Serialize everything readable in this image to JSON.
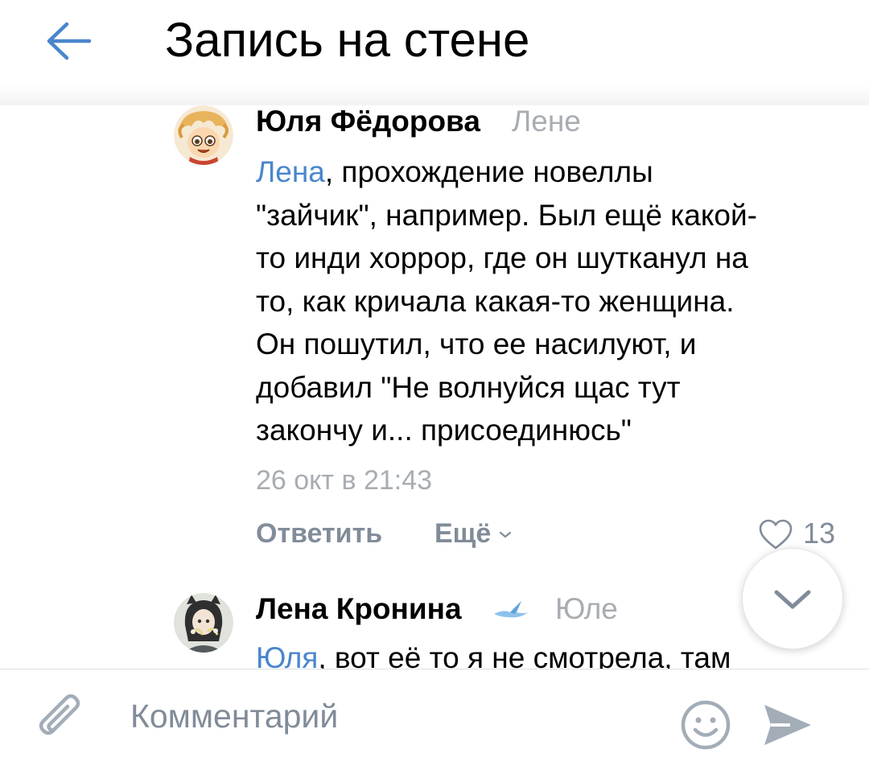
{
  "header": {
    "title": "Запись на стене",
    "back_icon": "arrow-left-icon",
    "accent_color": "#4986cc"
  },
  "comments": [
    {
      "author": "Юля Фёдорова",
      "reply_to": "Лене",
      "mention": "Лена",
      "text_lines": [
        ", прохождение новеллы",
        "\"зайчик\", например. Был ещё какой-",
        "то инди хоррор, где он шутканул на",
        "то, как кричала какая-то женщина.",
        "Он пошутил, что ее насилуют, и",
        "добавил \"Не волнуйся щас тут",
        "закончу и... присоединюсь\""
      ],
      "date": "26 окт в 21:43",
      "reply_label": "Ответить",
      "more_label": "Ещё",
      "likes": "13"
    },
    {
      "author": "Лена Кронина",
      "badge_icon": "bird-icon",
      "reply_to": "Юле",
      "mention": "Юля",
      "text_partial": ", вот её то я не смотрела, там"
    }
  ],
  "composer": {
    "placeholder": "Комментарий",
    "attach_icon": "paperclip-icon",
    "emoji_icon": "smile-icon",
    "send_icon": "send-icon"
  },
  "scroll_button_icon": "chevron-down-icon",
  "colors": {
    "link": "#4986cc",
    "secondary_text": "#818c99",
    "meta_text": "#a8adb3"
  }
}
